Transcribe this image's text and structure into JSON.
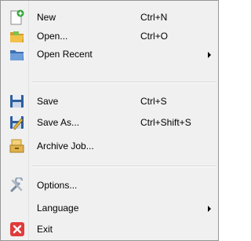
{
  "menu": {
    "items": [
      {
        "label": "New",
        "shortcut": "Ctrl+N",
        "icon": "new-document-icon"
      },
      {
        "label": "Open...",
        "shortcut": "Ctrl+O",
        "icon": "open-folder-icon"
      },
      {
        "label": "Open Recent",
        "shortcut": "",
        "icon": "recent-folder-icon",
        "submenu": true
      },
      {
        "label": "Save",
        "shortcut": "Ctrl+S",
        "icon": "save-icon"
      },
      {
        "label": "Save As...",
        "shortcut": "Ctrl+Shift+S",
        "icon": "save-as-icon"
      },
      {
        "label": "Archive Job...",
        "shortcut": "",
        "icon": "archive-icon"
      },
      {
        "label": "Options...",
        "shortcut": "",
        "icon": "options-tools-icon"
      },
      {
        "label": "Language",
        "shortcut": "",
        "icon": "",
        "submenu": true
      },
      {
        "label": "Exit",
        "shortcut": "",
        "icon": "exit-icon"
      }
    ]
  },
  "colors": {
    "menu_background": "#f0f0f0",
    "border": "#979797",
    "exit_red": "#e03b3b",
    "save_blue": "#2c5e9e",
    "folder_yellow": "#e8b33a"
  }
}
